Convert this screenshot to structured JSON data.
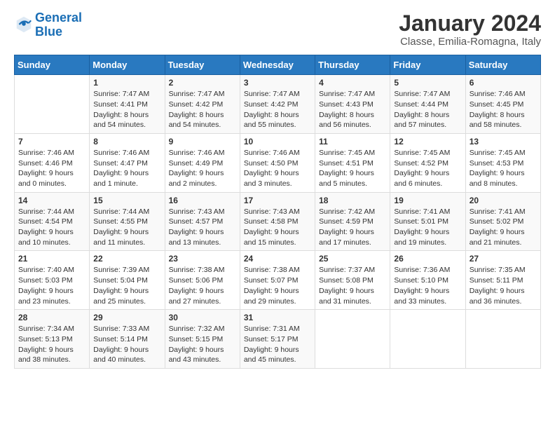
{
  "header": {
    "logo_line1": "General",
    "logo_line2": "Blue",
    "title": "January 2024",
    "subtitle": "Classe, Emilia-Romagna, Italy"
  },
  "calendar": {
    "weekdays": [
      "Sunday",
      "Monday",
      "Tuesday",
      "Wednesday",
      "Thursday",
      "Friday",
      "Saturday"
    ],
    "weeks": [
      [
        {
          "day": "",
          "sunrise": "",
          "sunset": "",
          "daylight": ""
        },
        {
          "day": "1",
          "sunrise": "Sunrise: 7:47 AM",
          "sunset": "Sunset: 4:41 PM",
          "daylight": "Daylight: 8 hours and 54 minutes."
        },
        {
          "day": "2",
          "sunrise": "Sunrise: 7:47 AM",
          "sunset": "Sunset: 4:42 PM",
          "daylight": "Daylight: 8 hours and 54 minutes."
        },
        {
          "day": "3",
          "sunrise": "Sunrise: 7:47 AM",
          "sunset": "Sunset: 4:42 PM",
          "daylight": "Daylight: 8 hours and 55 minutes."
        },
        {
          "day": "4",
          "sunrise": "Sunrise: 7:47 AM",
          "sunset": "Sunset: 4:43 PM",
          "daylight": "Daylight: 8 hours and 56 minutes."
        },
        {
          "day": "5",
          "sunrise": "Sunrise: 7:47 AM",
          "sunset": "Sunset: 4:44 PM",
          "daylight": "Daylight: 8 hours and 57 minutes."
        },
        {
          "day": "6",
          "sunrise": "Sunrise: 7:46 AM",
          "sunset": "Sunset: 4:45 PM",
          "daylight": "Daylight: 8 hours and 58 minutes."
        }
      ],
      [
        {
          "day": "7",
          "sunrise": "Sunrise: 7:46 AM",
          "sunset": "Sunset: 4:46 PM",
          "daylight": "Daylight: 9 hours and 0 minutes."
        },
        {
          "day": "8",
          "sunrise": "Sunrise: 7:46 AM",
          "sunset": "Sunset: 4:47 PM",
          "daylight": "Daylight: 9 hours and 1 minute."
        },
        {
          "day": "9",
          "sunrise": "Sunrise: 7:46 AM",
          "sunset": "Sunset: 4:49 PM",
          "daylight": "Daylight: 9 hours and 2 minutes."
        },
        {
          "day": "10",
          "sunrise": "Sunrise: 7:46 AM",
          "sunset": "Sunset: 4:50 PM",
          "daylight": "Daylight: 9 hours and 3 minutes."
        },
        {
          "day": "11",
          "sunrise": "Sunrise: 7:45 AM",
          "sunset": "Sunset: 4:51 PM",
          "daylight": "Daylight: 9 hours and 5 minutes."
        },
        {
          "day": "12",
          "sunrise": "Sunrise: 7:45 AM",
          "sunset": "Sunset: 4:52 PM",
          "daylight": "Daylight: 9 hours and 6 minutes."
        },
        {
          "day": "13",
          "sunrise": "Sunrise: 7:45 AM",
          "sunset": "Sunset: 4:53 PM",
          "daylight": "Daylight: 9 hours and 8 minutes."
        }
      ],
      [
        {
          "day": "14",
          "sunrise": "Sunrise: 7:44 AM",
          "sunset": "Sunset: 4:54 PM",
          "daylight": "Daylight: 9 hours and 10 minutes."
        },
        {
          "day": "15",
          "sunrise": "Sunrise: 7:44 AM",
          "sunset": "Sunset: 4:55 PM",
          "daylight": "Daylight: 9 hours and 11 minutes."
        },
        {
          "day": "16",
          "sunrise": "Sunrise: 7:43 AM",
          "sunset": "Sunset: 4:57 PM",
          "daylight": "Daylight: 9 hours and 13 minutes."
        },
        {
          "day": "17",
          "sunrise": "Sunrise: 7:43 AM",
          "sunset": "Sunset: 4:58 PM",
          "daylight": "Daylight: 9 hours and 15 minutes."
        },
        {
          "day": "18",
          "sunrise": "Sunrise: 7:42 AM",
          "sunset": "Sunset: 4:59 PM",
          "daylight": "Daylight: 9 hours and 17 minutes."
        },
        {
          "day": "19",
          "sunrise": "Sunrise: 7:41 AM",
          "sunset": "Sunset: 5:01 PM",
          "daylight": "Daylight: 9 hours and 19 minutes."
        },
        {
          "day": "20",
          "sunrise": "Sunrise: 7:41 AM",
          "sunset": "Sunset: 5:02 PM",
          "daylight": "Daylight: 9 hours and 21 minutes."
        }
      ],
      [
        {
          "day": "21",
          "sunrise": "Sunrise: 7:40 AM",
          "sunset": "Sunset: 5:03 PM",
          "daylight": "Daylight: 9 hours and 23 minutes."
        },
        {
          "day": "22",
          "sunrise": "Sunrise: 7:39 AM",
          "sunset": "Sunset: 5:04 PM",
          "daylight": "Daylight: 9 hours and 25 minutes."
        },
        {
          "day": "23",
          "sunrise": "Sunrise: 7:38 AM",
          "sunset": "Sunset: 5:06 PM",
          "daylight": "Daylight: 9 hours and 27 minutes."
        },
        {
          "day": "24",
          "sunrise": "Sunrise: 7:38 AM",
          "sunset": "Sunset: 5:07 PM",
          "daylight": "Daylight: 9 hours and 29 minutes."
        },
        {
          "day": "25",
          "sunrise": "Sunrise: 7:37 AM",
          "sunset": "Sunset: 5:08 PM",
          "daylight": "Daylight: 9 hours and 31 minutes."
        },
        {
          "day": "26",
          "sunrise": "Sunrise: 7:36 AM",
          "sunset": "Sunset: 5:10 PM",
          "daylight": "Daylight: 9 hours and 33 minutes."
        },
        {
          "day": "27",
          "sunrise": "Sunrise: 7:35 AM",
          "sunset": "Sunset: 5:11 PM",
          "daylight": "Daylight: 9 hours and 36 minutes."
        }
      ],
      [
        {
          "day": "28",
          "sunrise": "Sunrise: 7:34 AM",
          "sunset": "Sunset: 5:13 PM",
          "daylight": "Daylight: 9 hours and 38 minutes."
        },
        {
          "day": "29",
          "sunrise": "Sunrise: 7:33 AM",
          "sunset": "Sunset: 5:14 PM",
          "daylight": "Daylight: 9 hours and 40 minutes."
        },
        {
          "day": "30",
          "sunrise": "Sunrise: 7:32 AM",
          "sunset": "Sunset: 5:15 PM",
          "daylight": "Daylight: 9 hours and 43 minutes."
        },
        {
          "day": "31",
          "sunrise": "Sunrise: 7:31 AM",
          "sunset": "Sunset: 5:17 PM",
          "daylight": "Daylight: 9 hours and 45 minutes."
        },
        {
          "day": "",
          "sunrise": "",
          "sunset": "",
          "daylight": ""
        },
        {
          "day": "",
          "sunrise": "",
          "sunset": "",
          "daylight": ""
        },
        {
          "day": "",
          "sunrise": "",
          "sunset": "",
          "daylight": ""
        }
      ]
    ]
  }
}
